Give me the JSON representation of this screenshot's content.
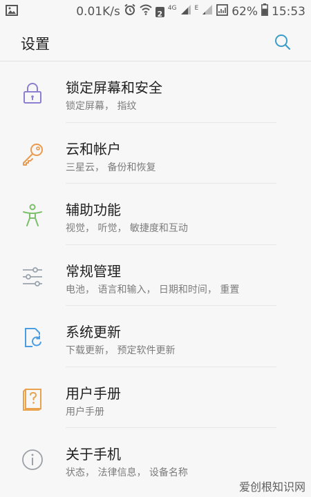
{
  "status_bar": {
    "speed": "0.01K/s",
    "net_type": "4G",
    "sim_badge": "2",
    "sim_letter": "E",
    "battery": "62%",
    "time": "15:53"
  },
  "header": {
    "title": "设置"
  },
  "settings": [
    {
      "title": "锁定屏幕和安全",
      "subtitle": "锁定屏幕， 指纹",
      "icon": "lock-icon",
      "color": "#8a7fd0"
    },
    {
      "title": "云和帐户",
      "subtitle": "三星云， 备份和恢复",
      "icon": "key-icon",
      "color": "#e99a4e"
    },
    {
      "title": "辅助功能",
      "subtitle": "视觉， 听觉， 敏捷度和互动",
      "icon": "accessibility-icon",
      "color": "#7bbf6a"
    },
    {
      "title": "常规管理",
      "subtitle": "电池， 语言和输入， 日期和时间， 重置",
      "icon": "sliders-icon",
      "color": "#9aa3ad"
    },
    {
      "title": "系统更新",
      "subtitle": "下载更新， 预定软件更新",
      "icon": "system-update-icon",
      "color": "#4a9de0"
    },
    {
      "title": "用户手册",
      "subtitle": "用户手册",
      "icon": "user-manual-icon",
      "color": "#e9a24e"
    },
    {
      "title": "关于手机",
      "subtitle": "状态， 法律信息， 设备名称",
      "icon": "info-icon",
      "color": "#9aa0a6"
    }
  ],
  "watermark": "爱创根知识网"
}
